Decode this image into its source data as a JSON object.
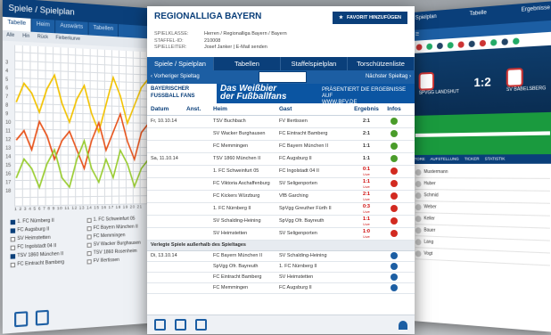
{
  "left": {
    "title": "Spiele / Spielplan",
    "tabs": [
      "Tabelle",
      "Heim",
      "Auswärts",
      "Tabellen"
    ],
    "subtabs": [
      "Alle",
      "Hin",
      "Rück",
      "Fieberkurve"
    ],
    "yticks": [
      "3",
      "4",
      "5",
      "6",
      "7",
      "8",
      "9",
      "10",
      "11",
      "12",
      "13",
      "14",
      "15",
      "16",
      "17",
      "18"
    ],
    "xticks": "1 2 3 4 5 6 7 8 9 10 11 12 13 14 15 16 17 18 19 20 21",
    "teams": [
      {
        "name": "1. FC Nürnberg II",
        "checked": true
      },
      {
        "name": "1. FC Schweinfurt 05",
        "checked": false
      },
      {
        "name": "FC Augsburg II",
        "checked": true
      },
      {
        "name": "FC Bayern München II",
        "checked": false
      },
      {
        "name": "SV Heimstetten",
        "checked": false
      },
      {
        "name": "FC Memmingen",
        "checked": false
      },
      {
        "name": "FC Ingolstadt 04 II",
        "checked": false
      },
      {
        "name": "SV Wacker Burghausen",
        "checked": false
      },
      {
        "name": "TSV 1860 München II",
        "checked": true
      },
      {
        "name": "TSV 1860 Rosenheim",
        "checked": false
      },
      {
        "name": "FC Eintracht Bamberg",
        "checked": false
      },
      {
        "name": "FV Illertissen",
        "checked": false
      }
    ]
  },
  "right": {
    "tabs": [
      "Spielplan",
      "Tabelle",
      "Ergebnisse"
    ],
    "home_team": "SPVGG LANDSHUT",
    "away_team": "SV BABELSBERG",
    "score": "1:2",
    "subtabs": [
      "TORE",
      "AUFSTELLUNG",
      "TICKER",
      "STATISTIK"
    ],
    "players": [
      "Mustermann",
      "Huber",
      "Schmid",
      "Weber",
      "Keller",
      "Bauer",
      "Lang",
      "Vogt"
    ]
  },
  "center": {
    "title": "REGIONALLIGA BAYERN",
    "fav_label": "FAVORIT HINZUFÜGEN",
    "info": [
      {
        "k": "SPIELKLASSE:",
        "v": "Herren / Regionalliga Bayern / Bayern"
      },
      {
        "k": "STAFFEL-ID:",
        "v": "210008"
      },
      {
        "k": "SPIELLEITER:",
        "v": "Josef Janker | E-Mail senden"
      }
    ],
    "tabs": [
      "Spiele / Spielplan",
      "Tabellen",
      "Staffelspielplan",
      "Torschützenliste"
    ],
    "nav": {
      "prev": "Vorheriger Spieltag",
      "selected": "15. Spieltag",
      "next": "Nächster Spieltag"
    },
    "banner": {
      "logo_line1": "BAYERISCHER",
      "logo_line2": "FUSSBALL FANS",
      "claim_line1": "Das Weißbier",
      "claim_line2": "der Fußballfans",
      "right_line1": "PRÄSENTIERT DIE ERGEBNISSE AUF",
      "right_line2": "WWW.BFV.DE"
    },
    "headers": {
      "date": "Datum",
      "time": "Anst.",
      "home": "Heim",
      "away": "Gast",
      "result": "Ergebnis",
      "info": "Infos"
    },
    "matches": [
      {
        "date": "Fr, 10.10.14",
        "time": "",
        "home": "TSV Buchbach",
        "away": "FV Illertissen",
        "result": "2:1",
        "live": false,
        "dot": "g"
      },
      {
        "date": "",
        "time": "",
        "home": "SV Wacker Burghausen",
        "away": "FC Eintracht Bamberg",
        "result": "2:1",
        "live": false,
        "dot": "g"
      },
      {
        "date": "",
        "time": "",
        "home": "FC Memmingen",
        "away": "FC Bayern München II",
        "result": "1:1",
        "live": false,
        "dot": "g"
      },
      {
        "date": "Sa, 11.10.14",
        "time": "",
        "home": "TSV 1860 München II",
        "away": "FC Augsburg II",
        "result": "1:1",
        "live": false,
        "dot": "g"
      },
      {
        "date": "",
        "time": "",
        "home": "1. FC Schweinfurt 05",
        "away": "FC Ingolstadt 04 II",
        "result": "0:1",
        "live": true,
        "dot": "r"
      },
      {
        "date": "",
        "time": "",
        "home": "FC Viktoria Aschaffenburg",
        "away": "SV Seligenporten",
        "result": "1:1",
        "live": true,
        "dot": "r"
      },
      {
        "date": "",
        "time": "",
        "home": "FC Kickers Würzburg",
        "away": "VfB Garching",
        "result": "2:1",
        "live": true,
        "dot": "r"
      },
      {
        "date": "",
        "time": "",
        "home": "1. FC Nürnberg II",
        "away": "SpVgg Greuther Fürth II",
        "result": "0:3",
        "live": true,
        "dot": "r"
      },
      {
        "date": "",
        "time": "",
        "home": "SV Schalding-Heining",
        "away": "SpVgg Ofr. Bayreuth",
        "result": "1:1",
        "live": true,
        "dot": "r"
      },
      {
        "date": "",
        "time": "",
        "home": "SV Heimstetten",
        "away": "SV Seligenporten",
        "result": "1:0",
        "live": true,
        "dot": "r"
      }
    ],
    "section_label": "Verlegte Spiele außerhalb des Spieltages",
    "postponed": [
      {
        "date": "Di, 13.10.14",
        "time": "",
        "home": "FC Bayern München II",
        "away": "SV Schalding-Heining",
        "result": "",
        "dot": "b"
      },
      {
        "date": "",
        "time": "",
        "home": "SpVgg Ofr. Bayreuth",
        "away": "1. FC Nürnberg II",
        "result": "",
        "dot": "b"
      },
      {
        "date": "",
        "time": "",
        "home": "FC Eintracht Bamberg",
        "away": "SV Heimstetten",
        "result": "",
        "dot": "b"
      },
      {
        "date": "",
        "time": "",
        "home": "FC Memmingen",
        "away": "FC Augsburg II",
        "result": "",
        "dot": "b"
      }
    ],
    "live_label": "Live",
    "colors": {
      "primary": "#0a3f7a",
      "accent": "#1c5ea3",
      "win": "#4a9c2a",
      "live": "#d22a20"
    }
  }
}
